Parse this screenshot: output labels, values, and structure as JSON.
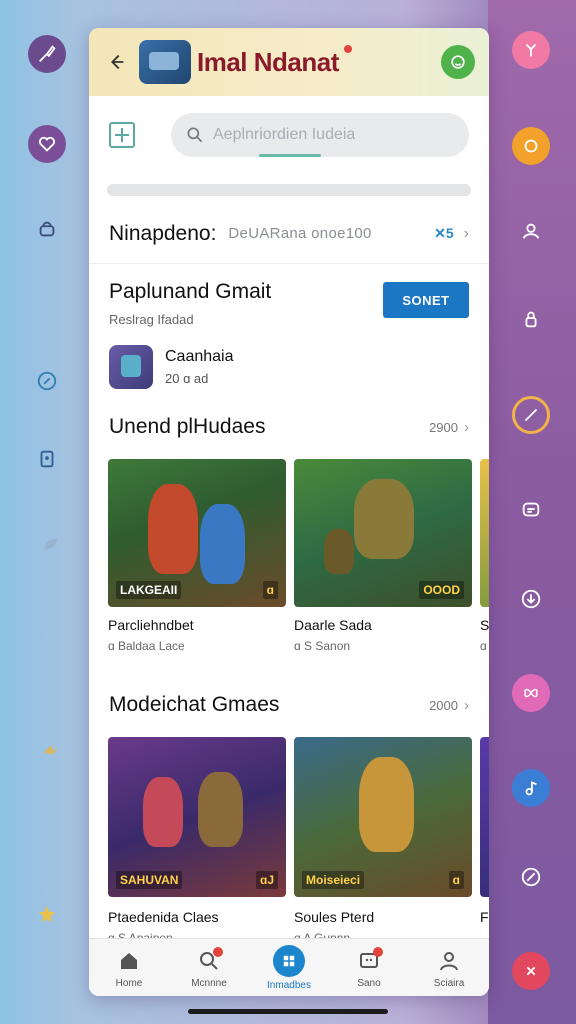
{
  "app": {
    "title": "Imal Ndanat"
  },
  "search": {
    "placeholder": "Aeplnriordien Iudeia"
  },
  "info_row": {
    "label": "Ninapdeno:",
    "value": "DeUARana onoe100",
    "badge": "✕5"
  },
  "section_a": {
    "title": "Paplunand Gmait",
    "subtitle": "Reslrag Ifadad",
    "button_label": "SONET"
  },
  "game": {
    "name": "Caanhaia",
    "meta": "20 ɑ ad"
  },
  "section_b": {
    "title": "Unend plHudaes",
    "count": "2900",
    "tiles": [
      {
        "label": "LAKGEAII",
        "badge": "ɑ",
        "caption": "Parcliehndbet",
        "meta": "ɑ Baldaa Lace"
      },
      {
        "label": "",
        "badge": "OOOD",
        "caption": "Daarle Sada",
        "meta": "ɑ S Sanon"
      },
      {
        "label": "",
        "badge": "",
        "caption": "Sc",
        "meta": "ɑ"
      }
    ]
  },
  "section_c": {
    "title": "Modeichat Gmaes",
    "count": "2000",
    "tiles": [
      {
        "label": "SAHUVAN",
        "badge": "ɑJ",
        "caption": "Ptaedenida Claes",
        "meta": "ɑ S Apaipen"
      },
      {
        "label": "Moiseieci",
        "badge": "ɑ",
        "caption": "Soules Pterd",
        "meta": "ɑ A Gunnn"
      },
      {
        "label": "",
        "badge": "",
        "caption": "Fr",
        "meta": ""
      }
    ]
  },
  "nav": [
    {
      "label": "Home",
      "icon": "home-icon"
    },
    {
      "label": "Mcnnne",
      "icon": "search-icon"
    },
    {
      "label": "Inmadbes",
      "icon": "grid-icon",
      "active": true
    },
    {
      "label": "Sano",
      "icon": "chat-icon"
    },
    {
      "label": "Sciaira",
      "icon": "person-icon"
    }
  ],
  "colors": {
    "accent": "#1b76c4",
    "title_red": "#8a1a2a",
    "profile_green": "#4fb24a",
    "alert_red": "#e2443d"
  }
}
